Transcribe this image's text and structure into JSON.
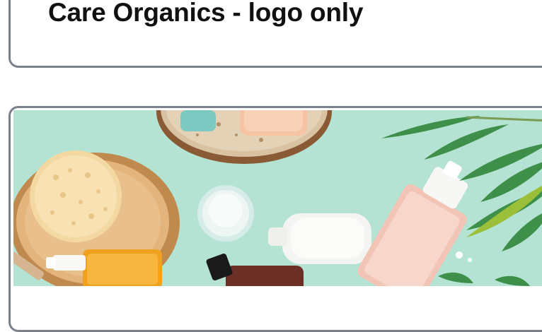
{
  "cards": [
    {
      "title": "Care Organics - logo only"
    },
    {
      "image": {
        "icon": "product-photo-organic-cosmetics",
        "background_color": "#aee0cf"
      }
    }
  ]
}
